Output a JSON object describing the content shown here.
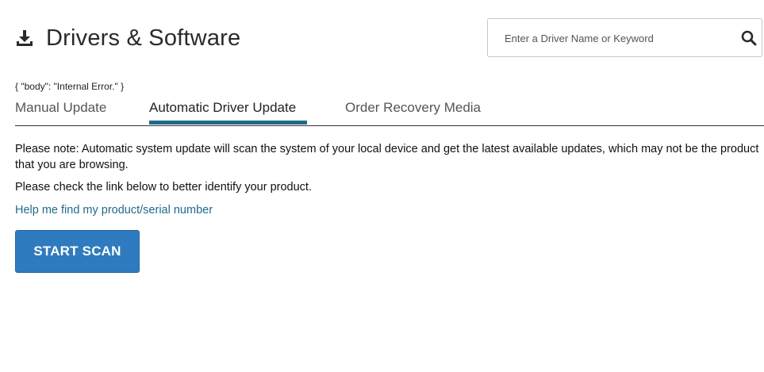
{
  "header": {
    "icon": "download-icon",
    "title": "Drivers & Software"
  },
  "search": {
    "placeholder": "Enter a Driver Name or Keyword",
    "value": "",
    "icon": "search-icon"
  },
  "error": {
    "text": "{ \"body\": \"Internal Error.\" }"
  },
  "tabs": [
    {
      "label": "Manual Update",
      "active": false
    },
    {
      "label": "Automatic Driver Update",
      "active": true
    },
    {
      "label": "Order Recovery Media",
      "active": false
    }
  ],
  "content": {
    "note": "Please note: Automatic system update will scan the system of your local device and get the latest available updates, which may not be the product that you are browsing.",
    "check": "Please check the link below to better identify your product.",
    "help_link": "Help me find my product/serial number",
    "scan_button": "START SCAN"
  },
  "colors": {
    "accent": "#1f6b8a",
    "button": "#2f7bbf",
    "text": "#222222"
  }
}
